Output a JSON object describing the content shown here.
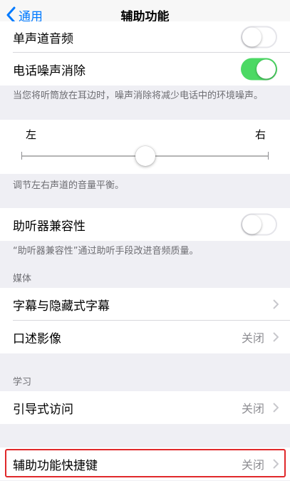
{
  "navbar": {
    "back_label": "通用",
    "title": "辅助功能"
  },
  "audio": {
    "mono_audio_label": "单声道音频",
    "mono_audio_on": false,
    "noise_cancel_label": "电话噪声消除",
    "noise_cancel_on": true,
    "noise_cancel_footer": "当您将听筒放在耳边时，噪声消除将减少电话中的环境噪声。"
  },
  "balance": {
    "left_label": "左",
    "right_label": "右",
    "value": 0.5,
    "footer": "调节左右声道的音量平衡。"
  },
  "hearing": {
    "label": "助听器兼容性",
    "on": false,
    "footer": "“助听器兼容性”通过助听手段改进音频质量。"
  },
  "media": {
    "header": "媒体",
    "items": [
      {
        "label": "字幕与隐藏式字幕",
        "value": ""
      },
      {
        "label": "口述影像",
        "value": "关闭"
      }
    ]
  },
  "learning": {
    "header": "学习",
    "items": [
      {
        "label": "引导式访问",
        "value": "关闭"
      }
    ]
  },
  "shortcut": {
    "label": "辅助功能快捷键",
    "value": "关闭"
  },
  "colors": {
    "accent": "#007aff",
    "toggle_on": "#4cd964",
    "highlight": "#e0282a"
  }
}
